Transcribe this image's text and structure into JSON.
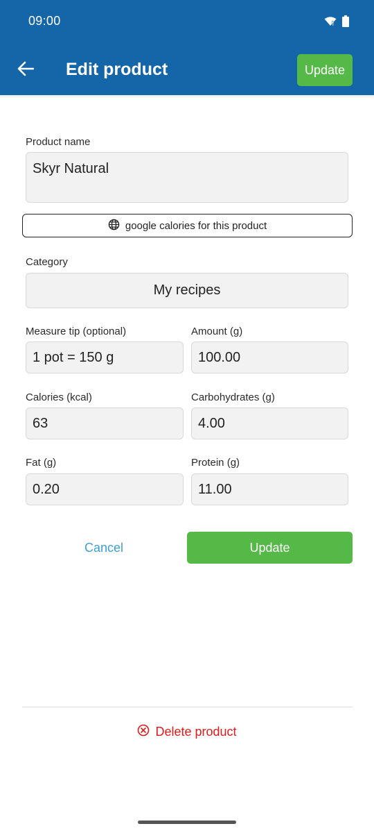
{
  "status_bar": {
    "time": "09:00"
  },
  "header": {
    "title": "Edit product",
    "update_label": "Update",
    "back_icon": "arrow-left-icon",
    "background_color": "#1565a9",
    "accent_color": "#55b947"
  },
  "form": {
    "product_name": {
      "label": "Product name",
      "value": "Skyr Natural"
    },
    "google_button": {
      "label": "google calories for this product",
      "icon": "globe-icon"
    },
    "category": {
      "label": "Category",
      "value": "My recipes"
    },
    "measure_tip": {
      "label": "Measure tip (optional)",
      "value": "1 pot = 150 g"
    },
    "amount": {
      "label": "Amount (g)",
      "value": "100.00"
    },
    "calories": {
      "label": "Calories (kcal)",
      "value": "63"
    },
    "carbohydrates": {
      "label": "Carbohydrates (g)",
      "value": "4.00"
    },
    "fat": {
      "label": "Fat (g)",
      "value": "0.20"
    },
    "protein": {
      "label": "Protein (g)",
      "value": "11.00"
    }
  },
  "actions": {
    "cancel_label": "Cancel",
    "update_label": "Update",
    "delete_label": "Delete product",
    "delete_icon": "close-circle-icon",
    "delete_color": "#e01a1a",
    "cancel_color": "#3d9fd4"
  }
}
